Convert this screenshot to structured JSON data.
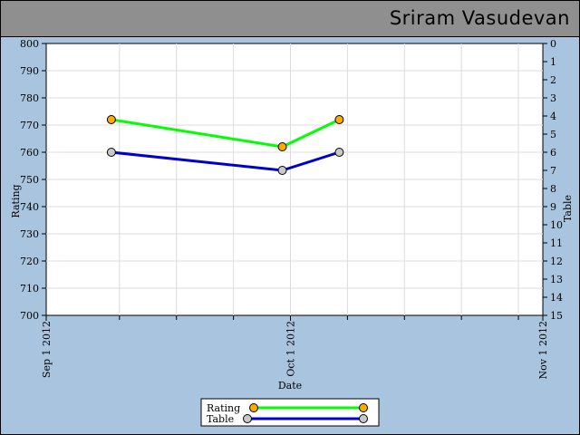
{
  "header": {
    "name": "Sriram Vasudevan"
  },
  "chart_data": {
    "type": "line",
    "xlabel": "Date",
    "ylabel": "Rating",
    "y2label": "Table",
    "x_ticks": [
      "Sep 1 2012",
      "Oct 1 2012",
      "Nov 1 2012"
    ],
    "xlim": [
      "2012-09-01",
      "2012-11-01"
    ],
    "ylim": [
      700,
      800
    ],
    "y2lim": [
      0,
      15
    ],
    "y2_inverted": true,
    "grid": true,
    "legend_position": "bottom-center",
    "series": [
      {
        "name": "Rating",
        "axis": "left",
        "color": "#00ff00",
        "marker_color": "#ffaa00",
        "points": [
          {
            "x": "2012-09-09",
            "y": 772
          },
          {
            "x": "2012-09-30",
            "y": 762
          },
          {
            "x": "2012-10-07",
            "y": 772
          }
        ]
      },
      {
        "name": "Table",
        "axis": "right",
        "color": "#0000cc",
        "marker_color": "#c8c8c8",
        "points": [
          {
            "x": "2012-09-09",
            "y": 6
          },
          {
            "x": "2012-09-30",
            "y": 7
          },
          {
            "x": "2012-10-07",
            "y": 6
          }
        ]
      }
    ]
  }
}
